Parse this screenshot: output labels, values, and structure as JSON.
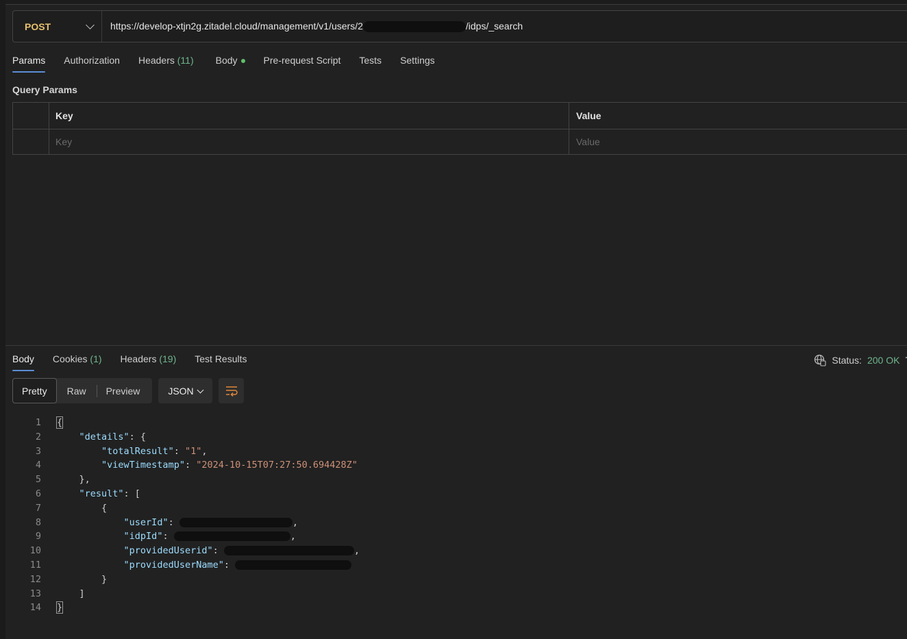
{
  "request": {
    "method": "POST",
    "url_prefix": "https://develop-xtjn2g.zitadel.cloud/management/v1/users/2",
    "url_suffix": "/idps/_search"
  },
  "req_tabs": [
    {
      "label": "Params",
      "active": true
    },
    {
      "label": "Authorization"
    },
    {
      "label": "Headers",
      "count": "(11)"
    },
    {
      "label": "Body",
      "dot": true
    },
    {
      "label": "Pre-request Script"
    },
    {
      "label": "Tests"
    },
    {
      "label": "Settings"
    }
  ],
  "query_params": {
    "title": "Query Params",
    "key_header": "Key",
    "value_header": "Value",
    "key_placeholder": "Key",
    "value_placeholder": "Value"
  },
  "res_tabs": [
    {
      "label": "Body",
      "active": true
    },
    {
      "label": "Cookies",
      "count": "(1)"
    },
    {
      "label": "Headers",
      "count": "(19)"
    },
    {
      "label": "Test Results"
    }
  ],
  "status": {
    "label": "Status:",
    "value": "200 OK",
    "trailing": "T"
  },
  "view_modes": [
    "Pretty",
    "Raw",
    "Preview"
  ],
  "format": "JSON",
  "icons": {
    "method_dropdown": "chevron-down-icon",
    "network": "globe-icon",
    "wrap": "wrap-lines-icon"
  },
  "code_lines": [
    {
      "n": "1",
      "t": "{"
    },
    {
      "n": "2",
      "k": "\"details\"",
      "t": ": {"
    },
    {
      "n": "3",
      "k": "\"totalResult\"",
      "t": ": ",
      "s": "\"1\"",
      "e": ","
    },
    {
      "n": "4",
      "k": "\"viewTimestamp\"",
      "t": ": ",
      "s": "\"2024-10-15T07:27:50.694428Z\""
    },
    {
      "n": "5",
      "t": "},"
    },
    {
      "n": "6",
      "k": "\"result\"",
      "t": ": ["
    },
    {
      "n": "7",
      "t": "{"
    },
    {
      "n": "8",
      "k": "\"userId\"",
      "t": ": ",
      "e": ","
    },
    {
      "n": "9",
      "k": "\"idpId\"",
      "t": ": ",
      "e": ","
    },
    {
      "n": "10",
      "k": "\"providedUserid\"",
      "t": ": ",
      "e": ","
    },
    {
      "n": "11",
      "k": "\"providedUserName\"",
      "t": ": "
    },
    {
      "n": "12",
      "t": "}"
    },
    {
      "n": "13",
      "t": "]"
    },
    {
      "n": "14",
      "t": "}"
    }
  ]
}
